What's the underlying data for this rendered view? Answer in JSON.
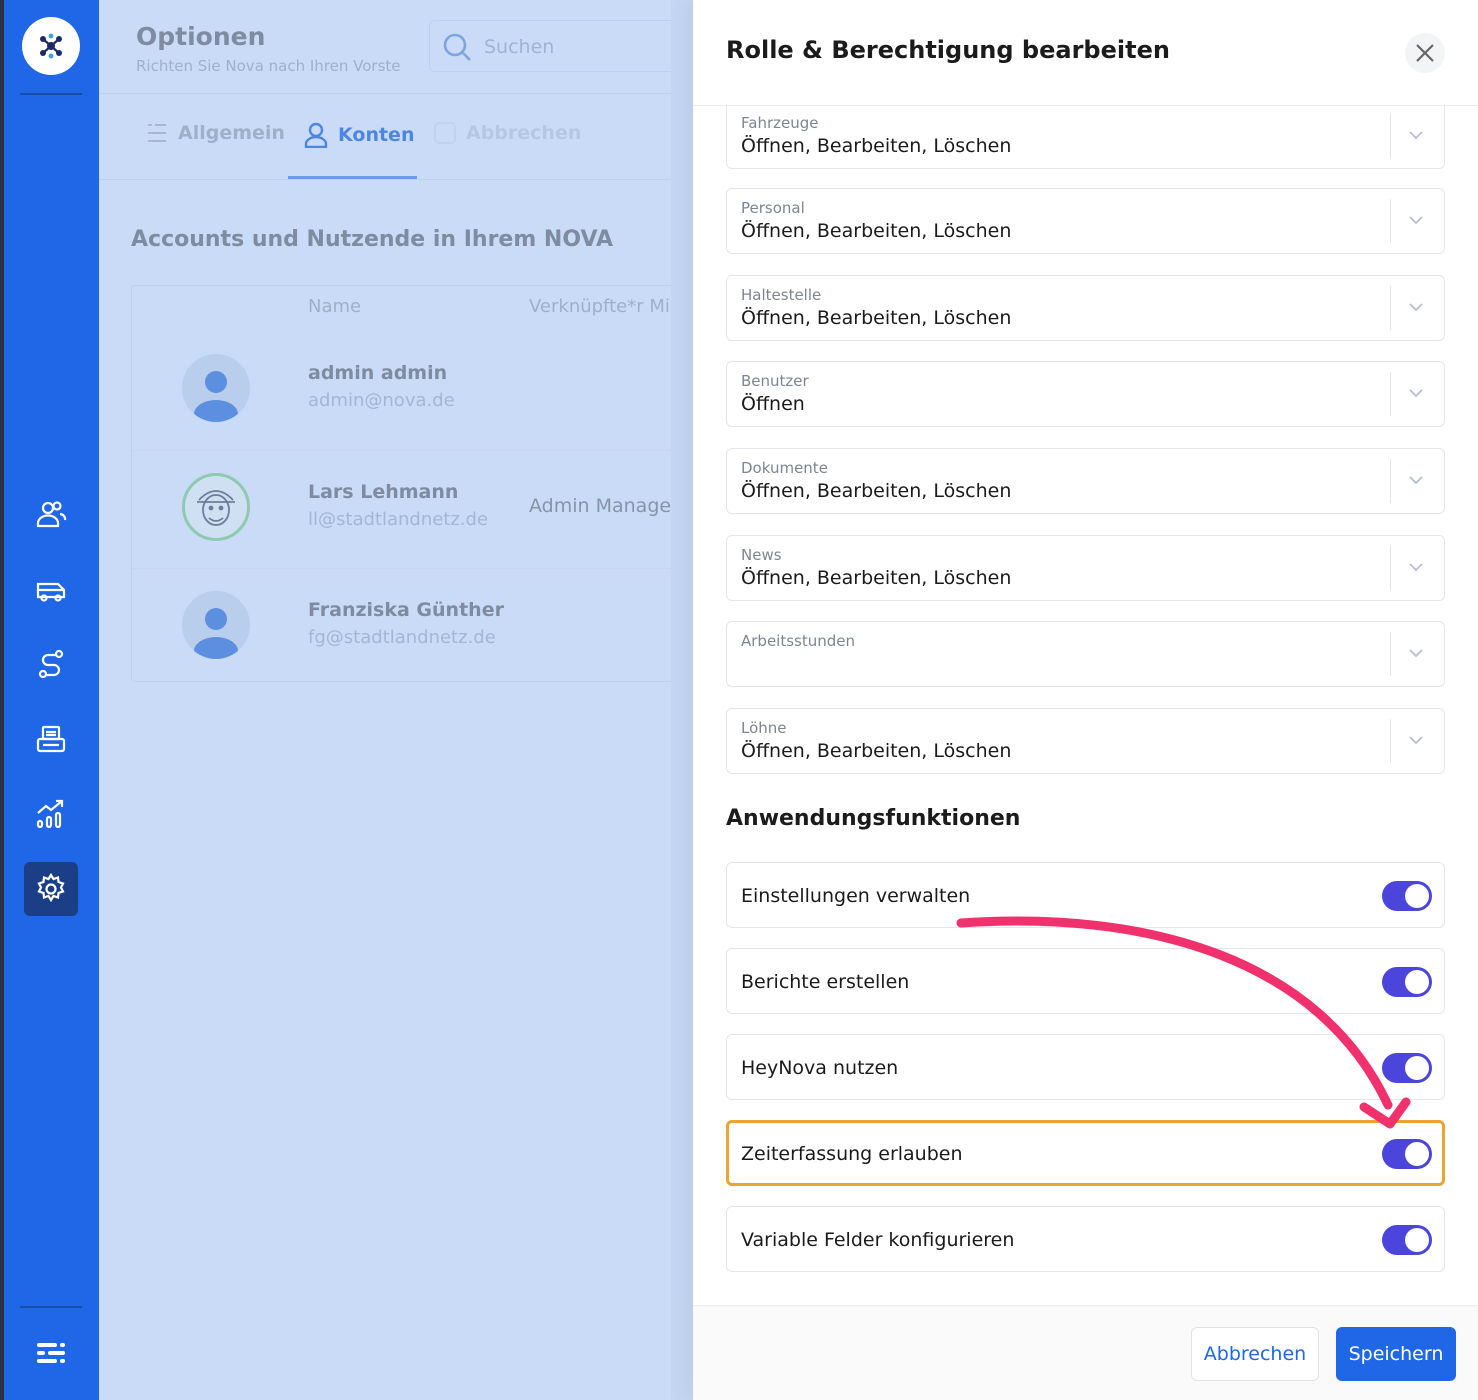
{
  "app": {
    "title": "Optionen",
    "subtitle": "Richten Sie Nova nach Ihren Vorste",
    "search_placeholder": "Suchen",
    "tabs": [
      {
        "label": "Allgemein"
      },
      {
        "label": "Konten"
      },
      {
        "label": "Abbrechen"
      }
    ],
    "section_title": "Accounts und Nutzende in Ihrem NOVA",
    "table": {
      "columns": [
        "Name",
        "Verknüpfte*r Mi"
      ],
      "rows": [
        {
          "name": "admin admin",
          "email": "admin@nova.de",
          "role": ""
        },
        {
          "name": "Lars Lehmann",
          "email": "ll@stadtlandnetz.de",
          "role": "Admin Manager"
        },
        {
          "name": "Franziska Günther",
          "email": "fg@stadtlandnetz.de",
          "role": ""
        }
      ]
    }
  },
  "sidebar": {
    "icons": [
      "logo-icon",
      "users-icon",
      "bus-icon",
      "route-icon",
      "printer-icon",
      "analytics-icon",
      "settings-icon",
      "menu-icon"
    ]
  },
  "modal": {
    "title": "Rolle & Berechtigung bearbeiten",
    "permissions": [
      {
        "label": "Fahrzeuge",
        "value": "Öffnen, Bearbeiten, Löschen"
      },
      {
        "label": "Personal",
        "value": "Öffnen, Bearbeiten, Löschen"
      },
      {
        "label": "Haltestelle",
        "value": "Öffnen, Bearbeiten, Löschen"
      },
      {
        "label": "Benutzer",
        "value": "Öffnen"
      },
      {
        "label": "Dokumente",
        "value": "Öffnen, Bearbeiten, Löschen"
      },
      {
        "label": "News",
        "value": "Öffnen, Bearbeiten, Löschen"
      },
      {
        "label": "Arbeitsstunden",
        "value": ""
      },
      {
        "label": "Löhne",
        "value": "Öffnen, Bearbeiten, Löschen"
      }
    ],
    "functions_title": "Anwendungsfunktionen",
    "functions": [
      {
        "label": "Einstellungen verwalten",
        "enabled": true
      },
      {
        "label": "Berichte erstellen",
        "enabled": true
      },
      {
        "label": "HeyNova nutzen",
        "enabled": true
      },
      {
        "label": "Zeiterfassung erlauben",
        "enabled": true,
        "highlighted": true
      },
      {
        "label": "Variable Felder konfigurieren",
        "enabled": true
      }
    ],
    "cancel_label": "Abbrechen",
    "save_label": "Speichern"
  },
  "colors": {
    "brand": "#1f67e6",
    "toggle_on": "#4b45dc",
    "highlight": "#e8a630",
    "arrow": "#f0316e"
  }
}
